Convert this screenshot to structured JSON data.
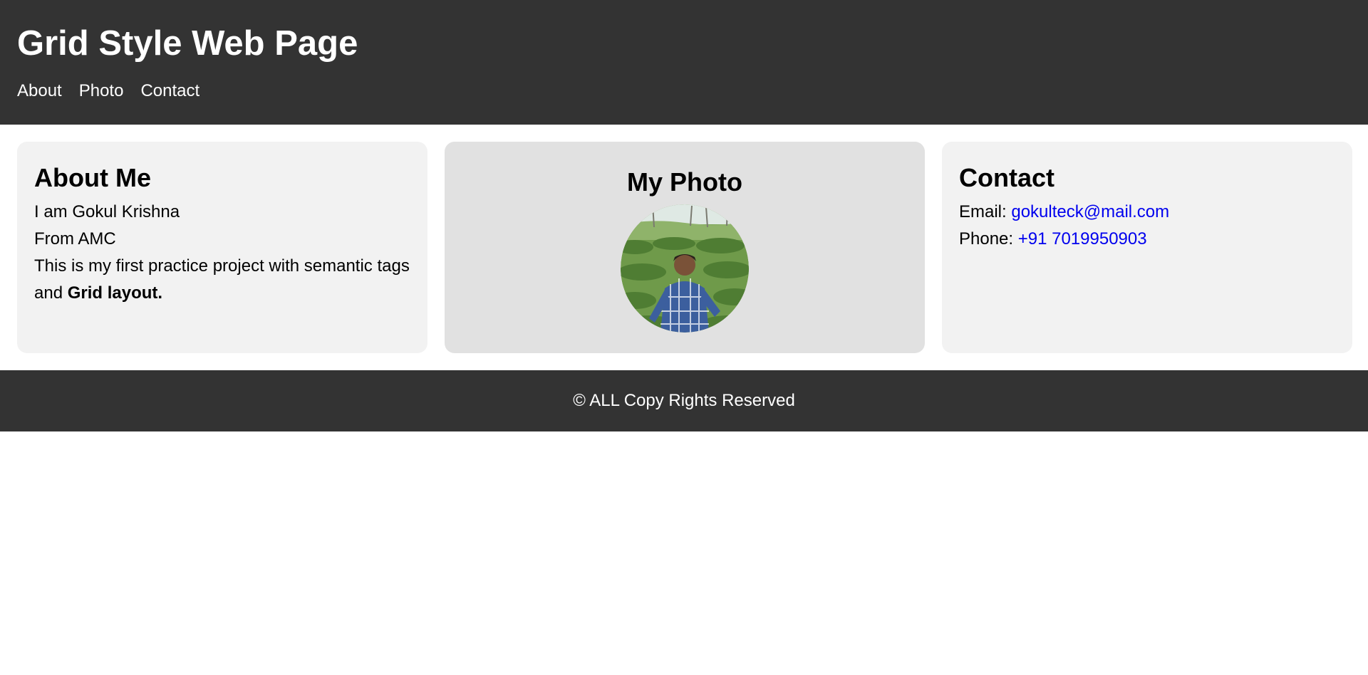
{
  "header": {
    "title": "Grid Style Web Page",
    "nav": [
      {
        "label": "About"
      },
      {
        "label": "Photo"
      },
      {
        "label": "Contact"
      }
    ]
  },
  "about": {
    "heading": "About Me",
    "line1": "I am Gokul Krishna",
    "line2": "From AMC",
    "line3_prefix": "This is my first practice project with semantic tags and ",
    "line3_bold": "Grid layout."
  },
  "photo": {
    "heading": "My Photo",
    "image_subject": "boy-in-tea-plantation"
  },
  "contact": {
    "heading": "Contact",
    "email_label": "Email: ",
    "email_value": "gokulteck@mail.com",
    "phone_label": "Phone: ",
    "phone_value": "+91 7019950903"
  },
  "footer": {
    "text": "© ALL Copy Rights Reserved"
  },
  "colors": {
    "header_bg": "#333333",
    "card_bg": "#f2f2f2",
    "photo_card_bg": "#e1e1e1",
    "link": "#0000ee"
  }
}
